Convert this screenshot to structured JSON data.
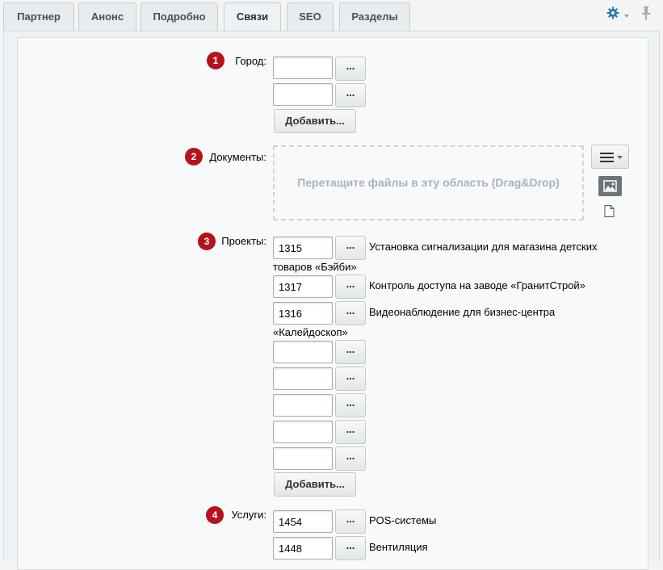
{
  "tabs": [
    {
      "label": "Партнер"
    },
    {
      "label": "Анонс"
    },
    {
      "label": "Подробно"
    },
    {
      "label": "Связи",
      "active": true
    },
    {
      "label": "SEO"
    },
    {
      "label": "Разделы"
    }
  ],
  "toolbar": {
    "settings_icon": "gear-icon",
    "pin_icon": "pin-icon",
    "accent": "#2a7ab8"
  },
  "fields": {
    "city": {
      "badge": "1",
      "label": "Город:",
      "values": [
        "",
        ""
      ],
      "add_label": "Добавить..."
    },
    "documents": {
      "badge": "2",
      "label": "Документы:",
      "dropzone_text": "Перетащите файлы в эту область (Drag&Drop)"
    },
    "projects": {
      "badge": "3",
      "label": "Проекты:",
      "rows": [
        {
          "id": "1315",
          "title_line1": "Установка сигнализации для магазина детских",
          "title_line2": "товаров «Бэйби»"
        },
        {
          "id": "1317",
          "title_line1": "Контроль доступа на заводе «ГранитСтрой»",
          "title_line2": ""
        },
        {
          "id": "1316",
          "title_line1": "Видеонаблюдение для бизнес-центра",
          "title_line2": "«Калейдоскоп»"
        },
        {
          "id": "",
          "title_line1": "",
          "title_line2": ""
        },
        {
          "id": "",
          "title_line1": "",
          "title_line2": ""
        },
        {
          "id": "",
          "title_line1": "",
          "title_line2": ""
        },
        {
          "id": "",
          "title_line1": "",
          "title_line2": ""
        },
        {
          "id": "",
          "title_line1": "",
          "title_line2": ""
        }
      ],
      "add_label": "Добавить..."
    },
    "services": {
      "badge": "4",
      "label": "Услуги:",
      "rows": [
        {
          "id": "1454",
          "title": "POS-системы"
        },
        {
          "id": "1448",
          "title": "Вентиляция"
        }
      ]
    }
  },
  "ellipsis": "...",
  "badge_color": "#b5121b"
}
